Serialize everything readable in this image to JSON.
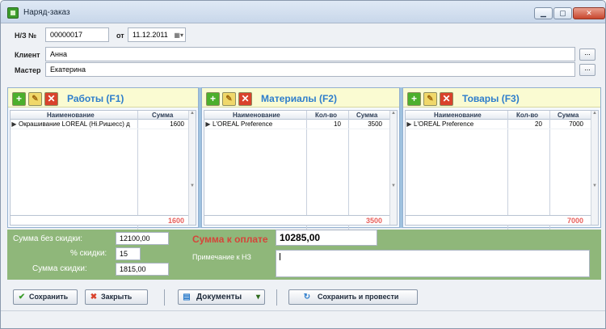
{
  "window": {
    "title": "Наряд-заказ",
    "minimize": "▁",
    "maximize": "▢",
    "close": "✕"
  },
  "header": {
    "order_label": "Н/З №",
    "order_number": "00000017",
    "date_label": "от",
    "date": "11.12.2011",
    "client_label": "Клиент",
    "client": "Анна",
    "master_label": "Мастер",
    "master": "Екатерина",
    "browse": "..."
  },
  "works": {
    "title": "Работы (F1)",
    "columns": [
      "Наименование",
      "Сумма"
    ],
    "rows": [
      {
        "name": "Окрашивание LOREAL (Hi.Ришесс) д",
        "sum": "1600"
      }
    ],
    "total": "1600"
  },
  "materials": {
    "title": "Материалы (F2)",
    "columns": [
      "Наименование",
      "Кол-во",
      "Сумма"
    ],
    "rows": [
      {
        "name": "L'OREAL Preference",
        "qty": "10",
        "sum": "3500"
      }
    ],
    "total": "3500"
  },
  "goods": {
    "title": "Товары (F3)",
    "columns": [
      "Наименование",
      "Кол-во",
      "Сумма"
    ],
    "rows": [
      {
        "name": "L'OREAL Preference",
        "qty": "20",
        "sum": "7000"
      }
    ],
    "total": "7000"
  },
  "summary": {
    "sum_no_discount_label": "Сумма без скидки:",
    "sum_no_discount": "12100,00",
    "discount_pct_label": "% скидки:",
    "discount_pct": "15",
    "discount_sum_label": "Сумма скидки:",
    "discount_sum": "1815,00",
    "to_pay_label": "Сумма к оплате",
    "to_pay": "10285,00",
    "note_label": "Примечание к НЗ",
    "note": ""
  },
  "buttons": {
    "save": "Сохранить",
    "close": "Закрыть",
    "documents": "Документы",
    "save_post": "Сохранить и провести"
  },
  "colors": {
    "accent": "#2d7dcc",
    "panel_bg": "#fafbd2",
    "summary_bg": "#8fb77a",
    "total": "#e8605c",
    "pay": "#d5453a"
  }
}
